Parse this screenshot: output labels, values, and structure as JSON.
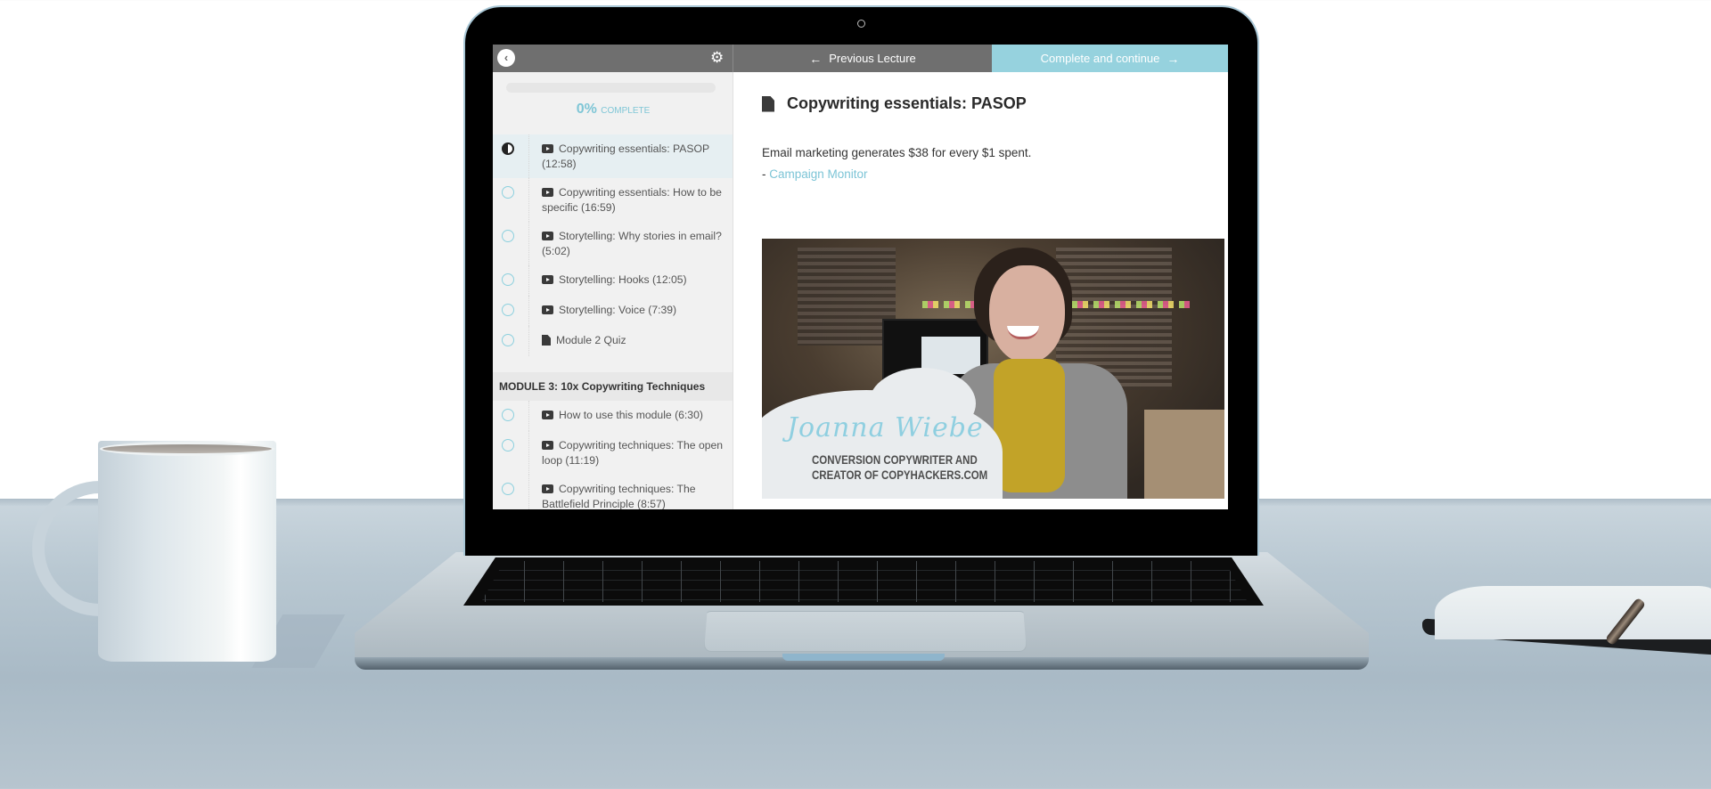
{
  "topbar": {
    "back_icon": "chevron-left-icon",
    "settings_icon": "gear-icon",
    "prev_label": "Previous Lecture",
    "next_label": "Complete and continue",
    "next_color": "#96d2de"
  },
  "progress": {
    "percent": 0,
    "percent_label": "0%",
    "complete_label": "COMPLETE"
  },
  "sidebar": {
    "items": [
      {
        "type": "video",
        "label": "Copywriting essentials: PASOP (12:58)",
        "status": "in-progress",
        "active": true
      },
      {
        "type": "video",
        "label": "Copywriting essentials: How to be specific (16:59)",
        "status": "incomplete"
      },
      {
        "type": "video",
        "label": "Storytelling: Why stories in email? (5:02)",
        "status": "incomplete"
      },
      {
        "type": "video",
        "label": "Storytelling: Hooks (12:05)",
        "status": "incomplete"
      },
      {
        "type": "video",
        "label": "Storytelling: Voice (7:39)",
        "status": "incomplete"
      },
      {
        "type": "doc",
        "label": "Module 2 Quiz",
        "status": "incomplete"
      }
    ],
    "module3": {
      "header": "MODULE 3: 10x Copywriting Techniques",
      "items": [
        {
          "type": "video",
          "label": "How to use this module (6:30)",
          "status": "incomplete"
        },
        {
          "type": "video",
          "label": "Copywriting techniques: The open loop (11:19)",
          "status": "incomplete"
        },
        {
          "type": "video",
          "label": "Copywriting techniques: The Battlefield Principle (8:57)",
          "status": "incomplete"
        }
      ]
    }
  },
  "content": {
    "title": "Copywriting essentials: PASOP",
    "quote": "Email marketing generates $38 for every $1 spent.",
    "attribution_prefix": "- ",
    "attribution_link": "Campaign Monitor",
    "link_color": "#7cc4d6",
    "video": {
      "presenter_name": "Joanna Wiebe",
      "caption_line1": "CONVERSION COPYWRITER AND",
      "caption_line2": "CREATOR OF COPYHACKERS.COM"
    }
  }
}
